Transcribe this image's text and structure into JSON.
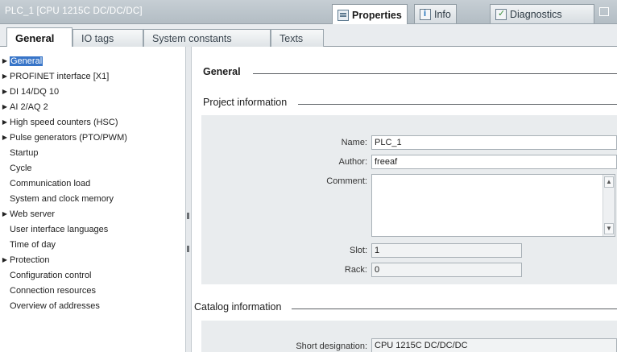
{
  "window": {
    "title": "PLC_1 [CPU 1215C DC/DC/DC]",
    "tabs": [
      {
        "label": "Properties",
        "icon": "properties-icon"
      },
      {
        "label": "Info",
        "icon": "info-icon"
      },
      {
        "label": "Diagnostics",
        "icon": "diagnostics-icon"
      }
    ]
  },
  "subtabs": [
    "General",
    "IO tags",
    "System constants",
    "Texts"
  ],
  "nav": {
    "items": [
      {
        "label": "General",
        "expandable": true,
        "selected": true
      },
      {
        "label": "PROFINET interface [X1]",
        "expandable": true
      },
      {
        "label": "DI 14/DQ 10",
        "expandable": true
      },
      {
        "label": "AI 2/AQ 2",
        "expandable": true
      },
      {
        "label": "High speed counters (HSC)",
        "expandable": true
      },
      {
        "label": "Pulse generators (PTO/PWM)",
        "expandable": true
      },
      {
        "label": "Startup",
        "expandable": false
      },
      {
        "label": "Cycle",
        "expandable": false
      },
      {
        "label": "Communication load",
        "expandable": false
      },
      {
        "label": "System and clock memory",
        "expandable": false
      },
      {
        "label": "Web server",
        "expandable": true
      },
      {
        "label": "User interface languages",
        "expandable": false
      },
      {
        "label": "Time of day",
        "expandable": false
      },
      {
        "label": "Protection",
        "expandable": true
      },
      {
        "label": "Configuration control",
        "expandable": false
      },
      {
        "label": "Connection resources",
        "expandable": false
      },
      {
        "label": "Overview of addresses",
        "expandable": false
      }
    ]
  },
  "content": {
    "general_heading": "General",
    "project_info_heading": "Project information",
    "name_label": "Name:",
    "name_value": "PLC_1",
    "author_label": "Author:",
    "author_value": "freeaf",
    "comment_label": "Comment:",
    "comment_value": "",
    "slot_label": "Slot:",
    "slot_value": "1",
    "rack_label": "Rack:",
    "rack_value": "0",
    "catalog_info_heading": "Catalog information",
    "short_designation_label": "Short designation:",
    "short_designation_value": "CPU 1215C DC/DC/DC"
  },
  "colors": {
    "selection": "#3875c8",
    "titlebar": "#b9c3ca",
    "panel": "#e9ecee"
  }
}
